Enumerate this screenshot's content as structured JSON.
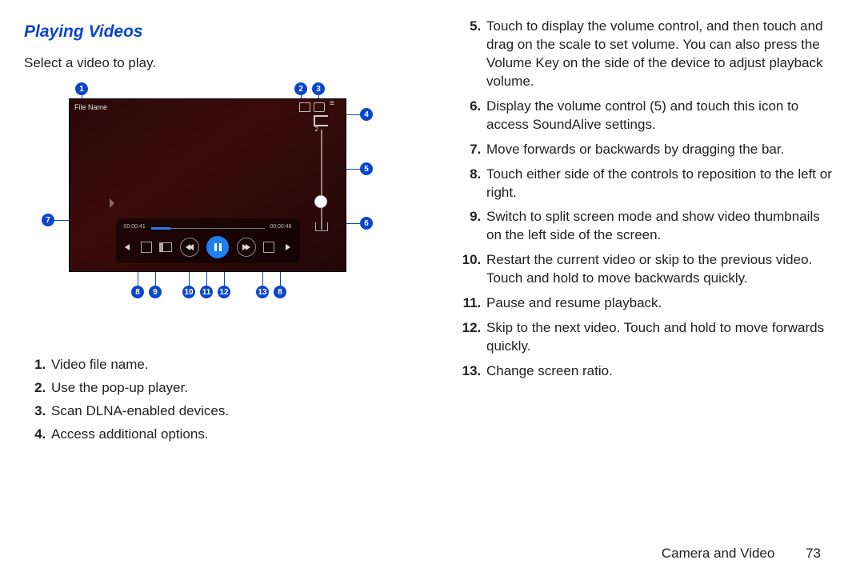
{
  "header": {
    "title": "Playing Videos",
    "intro": "Select a video to play."
  },
  "figure": {
    "filename": "File Name",
    "time_elapsed": "00:00:41",
    "time_total": "00:00:48",
    "volume_tick": "2",
    "callouts": [
      "1",
      "2",
      "3",
      "4",
      "5",
      "6",
      "7",
      "8",
      "9",
      "10",
      "11",
      "12",
      "13",
      "8"
    ],
    "icons": {
      "popup": "popup-icon",
      "dlna": "dlna-icon",
      "menu": "menu-icon",
      "volume": "volume-icon",
      "soundalive": "soundalive-icon",
      "chevron": "chevron-icon",
      "ratio": "ratio-icon",
      "split": "split-icon",
      "prev": "prev-icon",
      "pause": "pause-icon",
      "next": "next-icon",
      "grip": "grip-icon"
    }
  },
  "left_list": [
    "Video file name.",
    "Use the pop-up player.",
    "Scan DLNA-enabled devices.",
    "Access additional options."
  ],
  "right_list": [
    "Touch to display the volume control, and then touch and drag on the scale to set volume. You can also press the Volume Key on the side of the device to adjust playback volume.",
    "Display the volume control (5) and touch this icon to access SoundAlive settings.",
    "Move forwards or backwards by dragging the bar.",
    "Touch either side of the controls to reposition to the left or right.",
    "Switch to split screen mode and show video thumbnails on the left side of the screen.",
    "Restart the current video or skip to the previous video. Touch and hold to move backwards quickly.",
    "Pause and resume playback.",
    "Skip to the next video. Touch and hold to move forwards quickly.",
    "Change screen ratio."
  ],
  "footer": {
    "chapter": "Camera and Video",
    "page": "73"
  }
}
